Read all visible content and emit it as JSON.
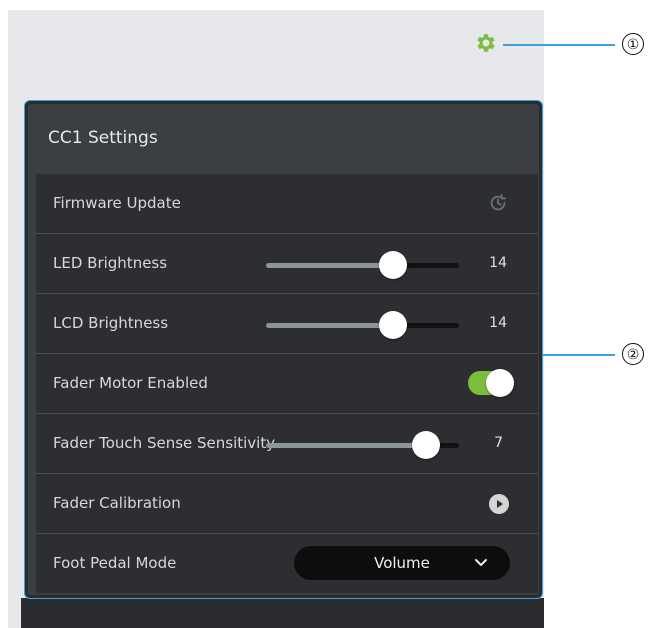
{
  "callouts": [
    "①",
    "②"
  ],
  "panel": {
    "title": "CC1 Settings",
    "rows": [
      {
        "label": "Firmware Update"
      },
      {
        "label": "LED Brightness",
        "value": "14",
        "level": 0.66
      },
      {
        "label": "LCD Brightness",
        "value": "14",
        "level": 0.66
      },
      {
        "label": "Fader Motor Enabled",
        "toggle_on": true
      },
      {
        "label": "Fader Touch Sense Sensitivity",
        "value": "7",
        "level": 0.83
      },
      {
        "label": "Fader Calibration"
      },
      {
        "label": "Foot Pedal Mode",
        "selected": "Volume"
      }
    ]
  },
  "colors": {
    "accent_green": "#7cbd3e",
    "callout_blue": "#3aa3d9"
  },
  "icons": {
    "settings": "gear-icon",
    "firmware": "firmware-update-icon",
    "calibration": "play-icon",
    "dropdown": "chevron-down-icon"
  }
}
